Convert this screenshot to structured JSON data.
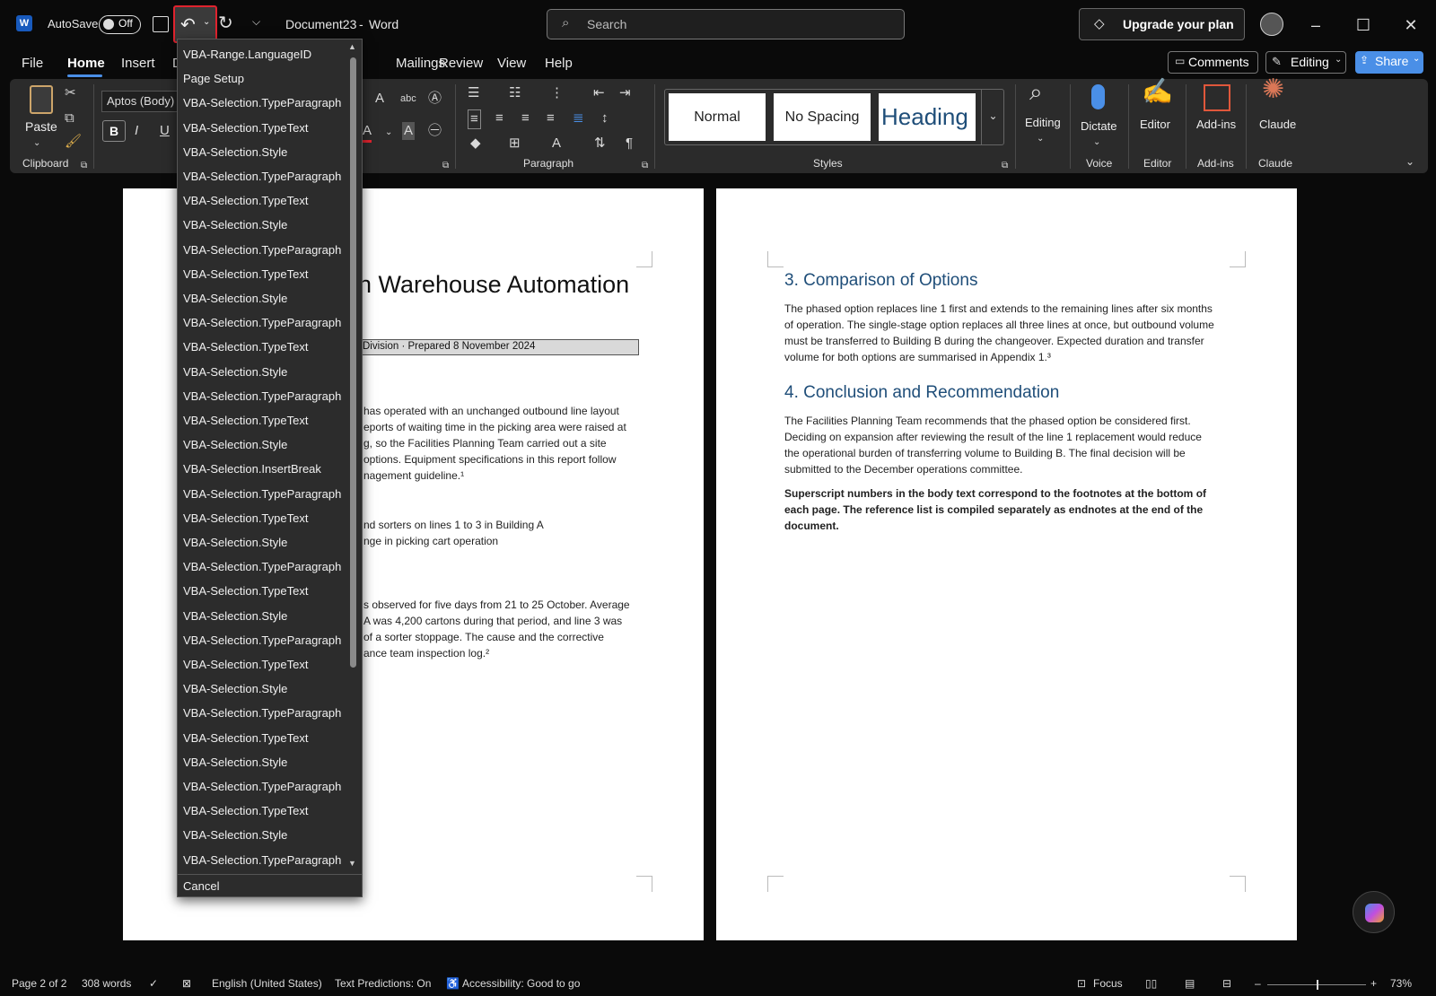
{
  "titlebar": {
    "autosave_label": "AutoSave",
    "autosave_state": "Off",
    "doc_title": "Document23",
    "separator": "-",
    "app_name": "Word",
    "search_placeholder": "Search",
    "upgrade_label": "Upgrade your plan"
  },
  "menu": {
    "tabs": [
      "File",
      "Home",
      "Insert",
      "D",
      "Mailings",
      "Review",
      "View",
      "Help"
    ],
    "comments_label": "Comments",
    "editing_label": "Editing",
    "share_label": "Share"
  },
  "ribbon": {
    "paste_label": "Paste",
    "clipboard_label": "Clipboard",
    "font_name": "Aptos (Body)",
    "paragraph_label": "Paragraph",
    "styles_label": "Styles",
    "styles": [
      "Normal",
      "No Spacing",
      "Heading 1"
    ],
    "editing_label": "Editing",
    "dictate_label": "Dictate",
    "voice_label": "Voice",
    "editor_label": "Editor",
    "editor_group": "Editor",
    "addins_label": "Add-ins",
    "addins_group": "Add-ins",
    "claude_label": "Claude",
    "claude_group": "Claude"
  },
  "undo_menu": {
    "items": [
      "VBA-Range.LanguageID",
      "Page Setup",
      "VBA-Selection.TypeParagraph",
      "VBA-Selection.TypeText",
      "VBA-Selection.Style",
      "VBA-Selection.TypeParagraph",
      "VBA-Selection.TypeText",
      "VBA-Selection.Style",
      "VBA-Selection.TypeParagraph",
      "VBA-Selection.TypeText",
      "VBA-Selection.Style",
      "VBA-Selection.TypeParagraph",
      "VBA-Selection.TypeText",
      "VBA-Selection.Style",
      "VBA-Selection.TypeParagraph",
      "VBA-Selection.TypeText",
      "VBA-Selection.Style",
      "VBA-Selection.InsertBreak",
      "VBA-Selection.TypeParagraph",
      "VBA-Selection.TypeText",
      "VBA-Selection.Style",
      "VBA-Selection.TypeParagraph",
      "VBA-Selection.TypeText",
      "VBA-Selection.Style",
      "VBA-Selection.TypeParagraph",
      "VBA-Selection.TypeText",
      "VBA-Selection.Style",
      "VBA-Selection.TypeParagraph",
      "VBA-Selection.TypeText",
      "VBA-Selection.Style",
      "VBA-Selection.TypeParagraph",
      "VBA-Selection.TypeText",
      "VBA-Selection.Style",
      "VBA-Selection.TypeParagraph"
    ],
    "cancel_label": "Cancel"
  },
  "page1": {
    "title_fragment": "n Warehouse Automation",
    "subtitle_fragment": "Division · Prepared 8 November 2024",
    "para1": [
      "has operated with an unchanged outbound line layout",
      "eports of waiting time in the picking area were raised at",
      "g, so the Facilities Planning Team carried out a site",
      " options. Equipment specifications in this report follow",
      "nagement guideline.¹"
    ],
    "para2": [
      "nd sorters on lines 1 to 3 in Building A",
      "nge in picking cart operation"
    ],
    "para3": [
      "s observed for five days from 21 to 25 October. Average",
      "A was 4,200 cartons during that period, and line 3 was",
      " of a sorter stoppage. The cause and the corrective",
      "ance team inspection log.²"
    ]
  },
  "page2": {
    "h3": "3. Comparison of Options",
    "p3": [
      "The phased option replaces line 1 first and extends to the remaining lines after six months",
      "of operation. The single-stage option replaces all three lines at once, but outbound volume",
      "must be transferred to Building B during the changeover. Expected duration and transfer",
      "volume for both options are summarised in Appendix 1.³"
    ],
    "h4": "4. Conclusion and Recommendation",
    "p4": [
      "The Facilities Planning Team recommends that the phased option be considered first.",
      "Deciding on expansion after reviewing the result of the line 1 replacement would reduce",
      "the operational burden of transferring volume to Building B. The final decision will be",
      "submitted to the December operations committee."
    ],
    "bold": [
      "Superscript numbers in the body text correspond to the footnotes at the bottom of",
      "each page. The reference list is compiled separately as endnotes at the end of the",
      "document."
    ]
  },
  "status": {
    "page": "Page 2 of 2",
    "words": "308 words",
    "language": "English (United States)",
    "predictions": "Text Predictions: On",
    "accessibility": "Accessibility: Good to go",
    "focus": "Focus",
    "zoom": "73%"
  }
}
